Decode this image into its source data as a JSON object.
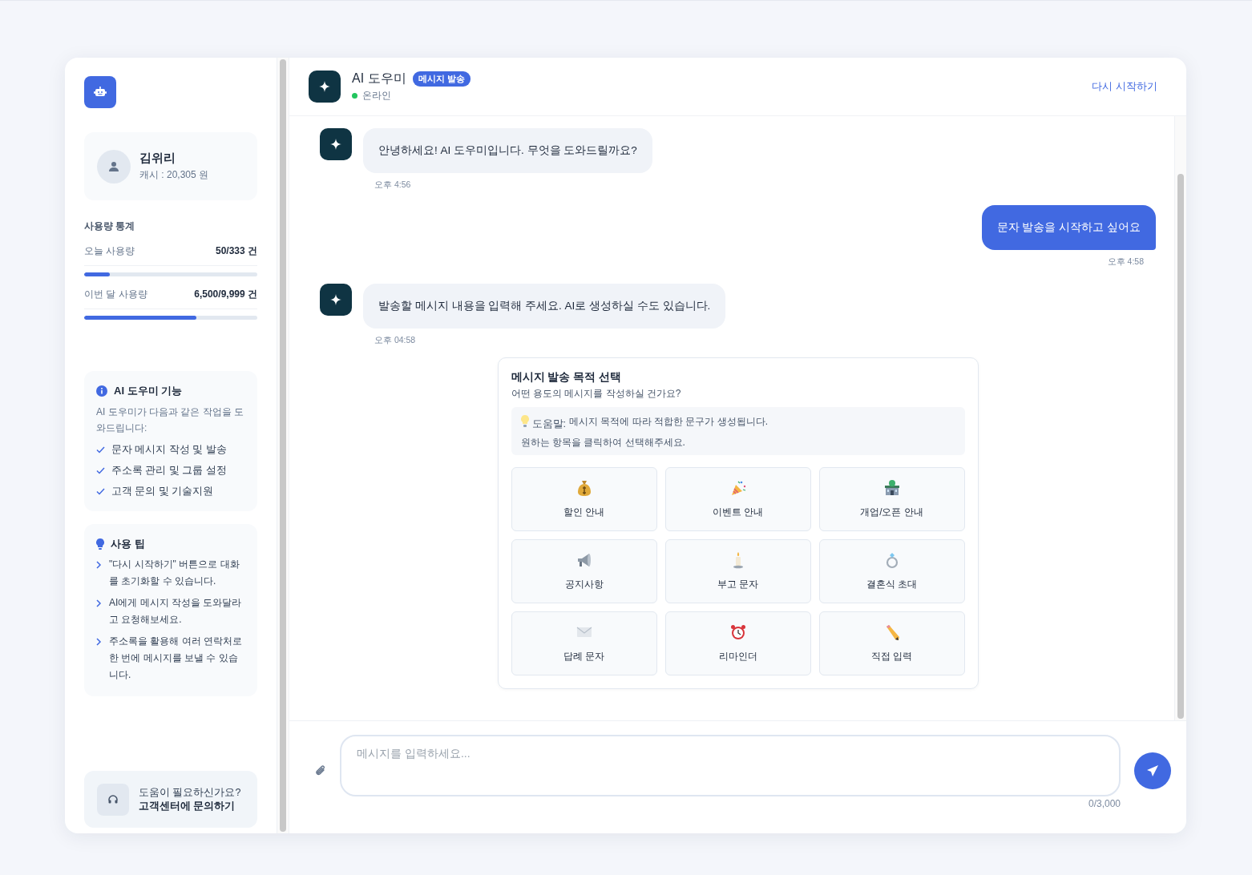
{
  "sidebar": {
    "user": {
      "name": "김위리",
      "cash": "캐시 : 20,305 원"
    },
    "usage": {
      "title": "사용량 통계",
      "rows": [
        {
          "label": "오늘 사용량",
          "value": "50/333 건",
          "level": 0.15
        },
        {
          "label": "이번 달 사용량",
          "value": "6,500/9,999 건",
          "level": 0.65
        }
      ]
    },
    "features": {
      "title": "AI 도우미 기능",
      "intro": "AI 도우미가 다음과 같은 작업을 도와드립니다:",
      "items": [
        "문자 메시지 작성 및 발송",
        "주소록 관리 및 그룹 설정",
        "고객 문의 및 기술지원"
      ]
    },
    "tips": {
      "title": "사용 팁",
      "items": [
        "\"다시 시작하기\" 버튼으로 대화를 초기화할 수 있습니다.",
        "AI에게 메시지 작성을 도와달라고 요청해보세요.",
        "주소록을 활용해 여러 연락처로 한 번에 메시지를 보낼 수 있습니다."
      ]
    },
    "help": {
      "question": "도움이 필요하신가요?",
      "link": "고객센터에 문의하기"
    }
  },
  "header": {
    "title": "AI 도우미",
    "badge": "메시지 발송",
    "status": "온라인",
    "online": true,
    "restart": "다시 시작하기"
  },
  "messages": [
    {
      "kind": "bot",
      "text": "안녕하세요! AI 도우미입니다. 무엇을 도와드릴까요?",
      "time": "오후 4:56"
    },
    {
      "kind": "user",
      "text": "문자 발송을 시작하고 싶어요",
      "time": "오후 4:58"
    },
    {
      "kind": "bot",
      "text": "발송할 메시지 내용을 입력해 주세요. AI로 생성하실 수도 있습니다.",
      "time": "오후 04:58"
    }
  ],
  "purpose": {
    "title": "메시지 발송 목적 선택",
    "subtitle": "어떤 용도의 메시지를 작성하실 건가요?",
    "hint_label": "도움말:",
    "hint_text": "메시지 목적에 따라 적합한 문구가 생성됩니다.",
    "hint_line2": "원하는 항목을 클릭하여 선택해주세요.",
    "options": [
      {
        "label": "할인 안내"
      },
      {
        "label": "이벤트 안내"
      },
      {
        "label": "개업/오픈 안내"
      },
      {
        "label": "공지사항"
      },
      {
        "label": "부고 문자"
      },
      {
        "label": "결혼식 초대"
      },
      {
        "label": "답례 문자"
      },
      {
        "label": "리마인더"
      },
      {
        "label": "직접 입력"
      }
    ]
  },
  "composer": {
    "placeholder": "메시지를 입력하세요...",
    "counter": "0/3,000"
  }
}
